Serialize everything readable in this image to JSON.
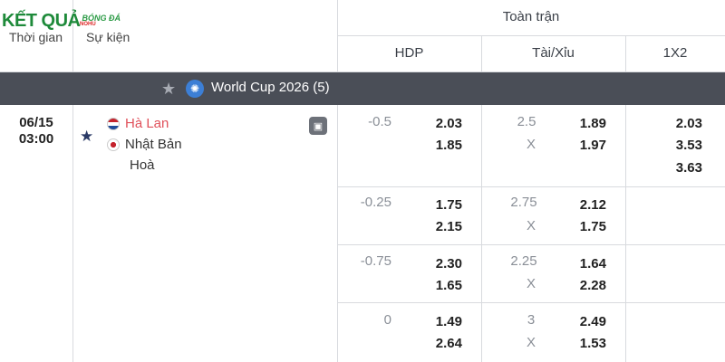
{
  "brand": {
    "logo_text": "KẾT QUẢ",
    "logo_sub": "BÓNG ĐÁ",
    "logo_tag": "NOHU"
  },
  "header": {
    "time_label": "Thời gian",
    "event_label": "Sự kiện",
    "full_match": "Toàn trận",
    "hdp": "HDP",
    "ou": "Tài/Xỉu",
    "x12": "1X2"
  },
  "league": {
    "name": "World Cup 2026 (5)",
    "icon": "globe-icon"
  },
  "match": {
    "date": "06/15",
    "time": "03:00",
    "home": "Hà Lan",
    "away": "Nhật Bản",
    "draw": "Hoà"
  },
  "odds": [
    {
      "hdp_line": "-0.5",
      "hdp_home": "2.03",
      "hdp_away": "1.85",
      "ou_line": "2.5",
      "ou_x": "X",
      "ou_over": "1.89",
      "ou_under": "1.97",
      "x12": [
        "2.03",
        "3.53",
        "3.63"
      ]
    },
    {
      "hdp_line": "-0.25",
      "hdp_home": "1.75",
      "hdp_away": "2.15",
      "ou_line": "2.75",
      "ou_x": "X",
      "ou_over": "2.12",
      "ou_under": "1.75"
    },
    {
      "hdp_line": "-0.75",
      "hdp_home": "2.30",
      "hdp_away": "1.65",
      "ou_line": "2.25",
      "ou_x": "X",
      "ou_over": "1.64",
      "ou_under": "2.28"
    },
    {
      "hdp_line": "0",
      "hdp_home": "1.49",
      "hdp_away": "2.64",
      "ou_line": "3",
      "ou_x": "X",
      "ou_over": "2.49",
      "ou_under": "1.53"
    }
  ],
  "colors": {
    "league_bar": "#4a4e57",
    "home_team": "#e0505a",
    "logo_green": "#1e8a3a"
  }
}
